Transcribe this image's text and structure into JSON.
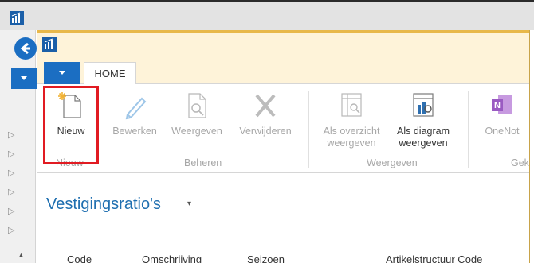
{
  "outer": {
    "nav_chevrons": [
      "▷",
      "▷",
      "▷",
      "▷",
      "▷",
      "▷"
    ],
    "scroll_up": "▲"
  },
  "tabs": {
    "home": "HOME"
  },
  "ribbon": {
    "nieuw": "Nieuw",
    "bewerken": "Bewerken",
    "weergeven": "Weergeven",
    "verwijderen": "Verwijderen",
    "als_overzicht_1": "Als overzicht",
    "als_overzicht_2": "weergeven",
    "als_diagram_1": "Als diagram",
    "als_diagram_2": "weergeven",
    "onenote": "OneNot",
    "groups": {
      "nieuw": "Nieuw",
      "beheren": "Beheren",
      "weergeven": "Weergeven",
      "gek": "Gek"
    }
  },
  "page": {
    "title": "Vestigingsratio's",
    "title_caret": "▾"
  },
  "columns": [
    "Code",
    "Omschrijving",
    "Seizoen",
    "Artikelstructuur Code"
  ],
  "colors": {
    "accent": "#1b6ec2",
    "highlight": "#e11b22",
    "title": "#1f6fb0"
  }
}
